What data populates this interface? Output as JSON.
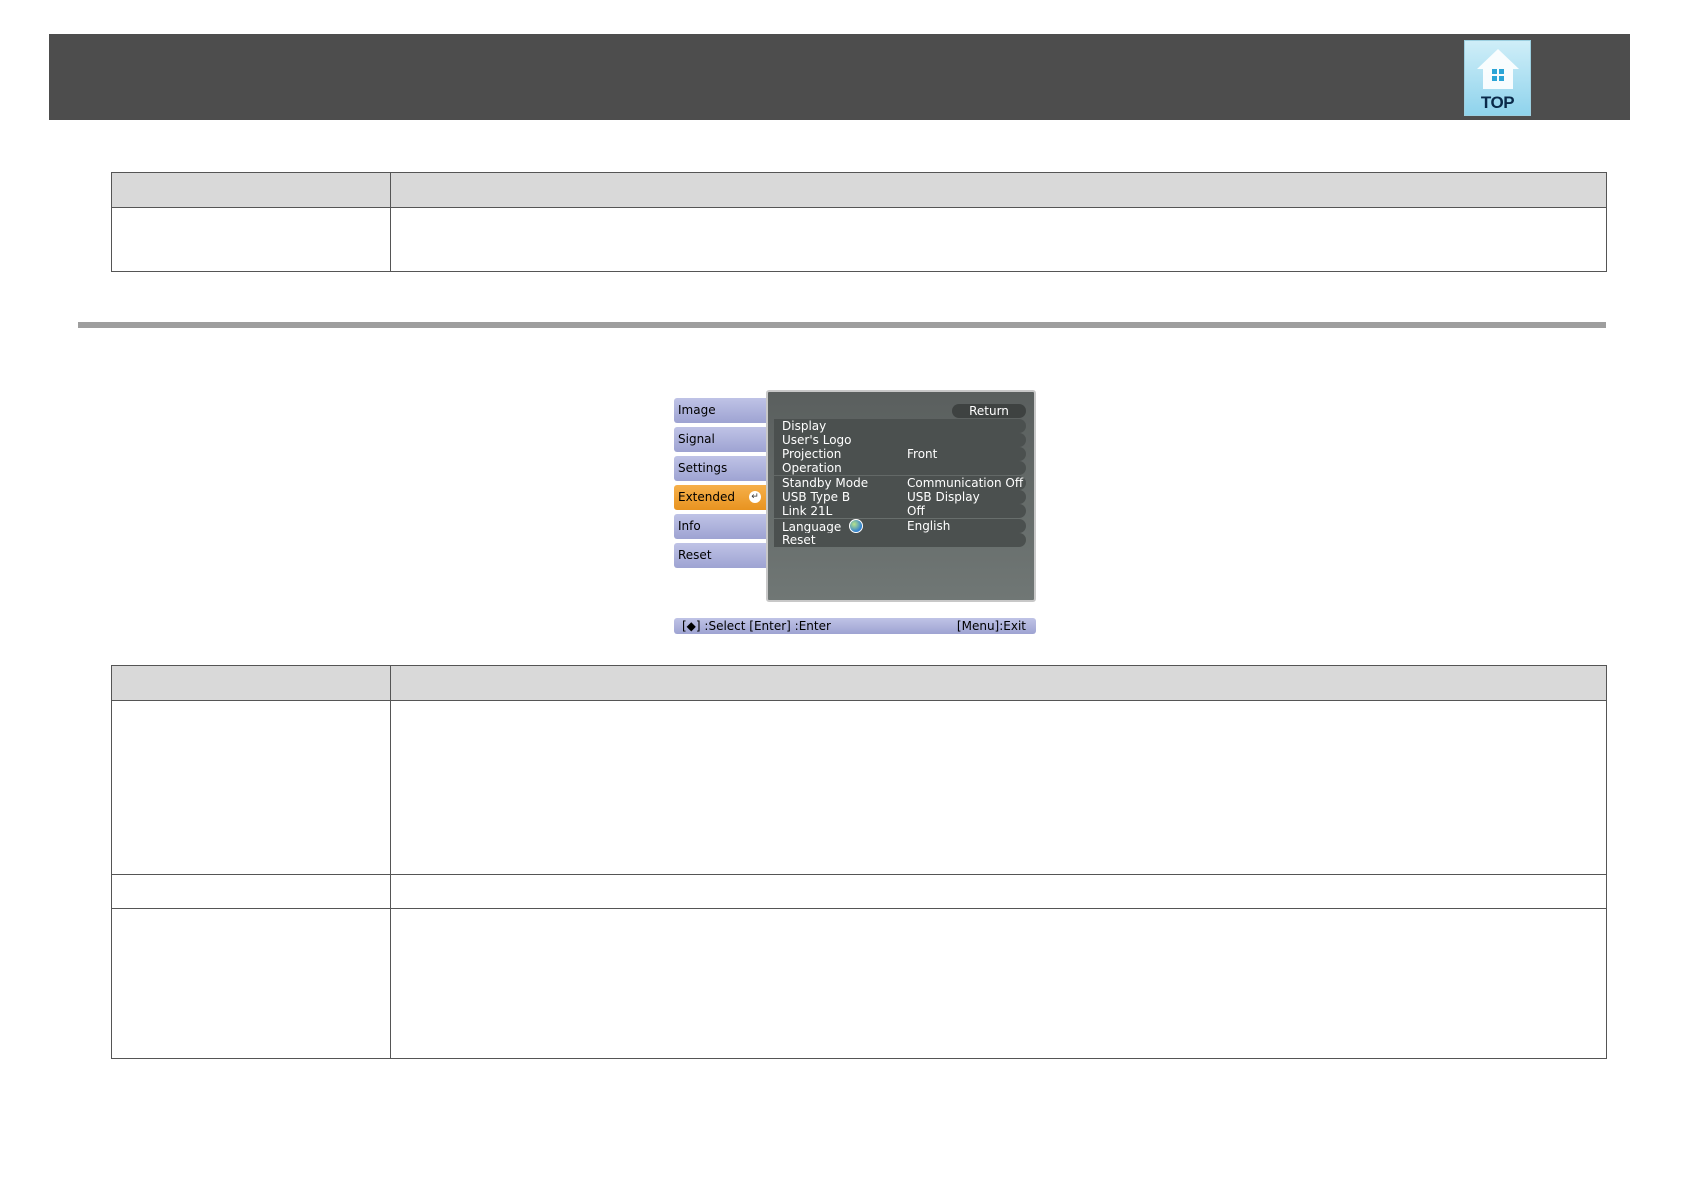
{
  "header": {
    "top_button_label": "TOP"
  },
  "osd_menu": {
    "tabs": [
      {
        "label": "Image"
      },
      {
        "label": "Signal"
      },
      {
        "label": "Settings"
      },
      {
        "label": "Extended",
        "active": true
      },
      {
        "label": "Info"
      },
      {
        "label": "Reset"
      }
    ],
    "return_label": "Return",
    "items": [
      {
        "name": "Display",
        "value": ""
      },
      {
        "name": "User's Logo",
        "value": ""
      },
      {
        "name": "Projection",
        "value": "Front"
      },
      {
        "name": "Operation",
        "value": ""
      },
      {
        "name": "Standby Mode",
        "value": "Communication Off"
      },
      {
        "name": "USB Type B",
        "value": "USB Display"
      },
      {
        "name": "Link 21L",
        "value": "Off"
      },
      {
        "name": "Language",
        "value": "English",
        "icon": "globe-icon"
      },
      {
        "name": "Reset",
        "value": ""
      }
    ],
    "help_left": "[◆] :Select  [Enter] :Enter",
    "help_right": "[Menu]:Exit"
  },
  "colors": {
    "header_bg": "#4d4d4d",
    "table_header_bg": "#d9d9d9",
    "active_tab": "#f0a030",
    "tab": "#aeb2dc"
  }
}
